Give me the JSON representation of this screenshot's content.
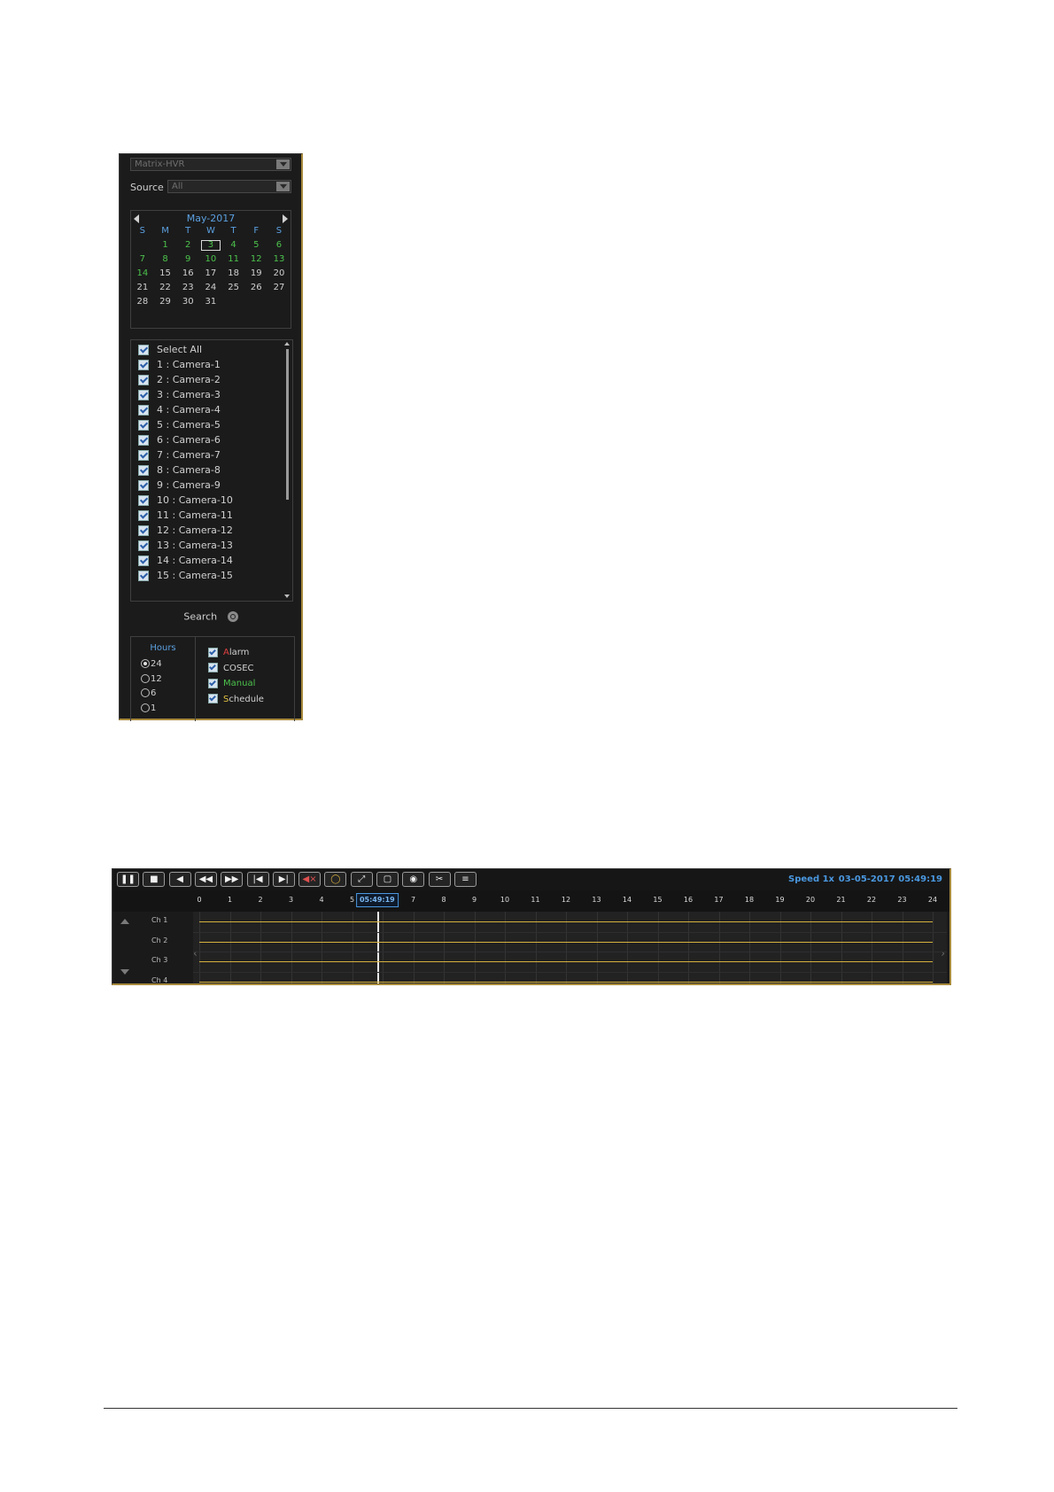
{
  "search_panel": {
    "device_dropdown": "Matrix-HVR",
    "source_label": "Source",
    "source_dropdown": "All",
    "calendar": {
      "title": "May-2017",
      "weekdays": [
        "S",
        "M",
        "T",
        "W",
        "T",
        "F",
        "S"
      ],
      "days": [
        {
          "d": "",
          "c": "nrec"
        },
        {
          "d": "1",
          "c": "rec"
        },
        {
          "d": "2",
          "c": "rec"
        },
        {
          "d": "3",
          "c": "rec sel"
        },
        {
          "d": "4",
          "c": "rec"
        },
        {
          "d": "5",
          "c": "rec"
        },
        {
          "d": "6",
          "c": "rec"
        },
        {
          "d": "7",
          "c": "rec"
        },
        {
          "d": "8",
          "c": "rec"
        },
        {
          "d": "9",
          "c": "rec"
        },
        {
          "d": "10",
          "c": "rec"
        },
        {
          "d": "11",
          "c": "rec"
        },
        {
          "d": "12",
          "c": "rec"
        },
        {
          "d": "13",
          "c": "rec"
        },
        {
          "d": "14",
          "c": "rec"
        },
        {
          "d": "15",
          "c": "nrec"
        },
        {
          "d": "16",
          "c": "nrec"
        },
        {
          "d": "17",
          "c": "nrec"
        },
        {
          "d": "18",
          "c": "nrec"
        },
        {
          "d": "19",
          "c": "nrec"
        },
        {
          "d": "20",
          "c": "nrec"
        },
        {
          "d": "21",
          "c": "nrec"
        },
        {
          "d": "22",
          "c": "nrec"
        },
        {
          "d": "23",
          "c": "nrec"
        },
        {
          "d": "24",
          "c": "nrec"
        },
        {
          "d": "25",
          "c": "nrec"
        },
        {
          "d": "26",
          "c": "nrec"
        },
        {
          "d": "27",
          "c": "nrec"
        },
        {
          "d": "28",
          "c": "nrec"
        },
        {
          "d": "29",
          "c": "nrec"
        },
        {
          "d": "30",
          "c": "nrec"
        },
        {
          "d": "31",
          "c": "nrec"
        }
      ],
      "recorded_color": "#4cc24c",
      "selected_day": "3"
    },
    "cameras": [
      {
        "label": "Select All",
        "checked": true
      },
      {
        "label": "1 : Camera-1",
        "checked": true
      },
      {
        "label": "2 : Camera-2",
        "checked": true
      },
      {
        "label": "3 : Camera-3",
        "checked": true
      },
      {
        "label": "4 : Camera-4",
        "checked": true
      },
      {
        "label": "5 : Camera-5",
        "checked": true
      },
      {
        "label": "6 : Camera-6",
        "checked": true
      },
      {
        "label": "7 : Camera-7",
        "checked": true
      },
      {
        "label": "8 : Camera-8",
        "checked": true
      },
      {
        "label": "9 : Camera-9",
        "checked": true
      },
      {
        "label": "10 : Camera-10",
        "checked": true
      },
      {
        "label": "11 : Camera-11",
        "checked": true
      },
      {
        "label": "12 : Camera-12",
        "checked": true
      },
      {
        "label": "13 : Camera-13",
        "checked": true
      },
      {
        "label": "14 : Camera-14",
        "checked": true
      },
      {
        "label": "15 : Camera-15",
        "checked": true
      }
    ],
    "search_label": "Search",
    "hours": {
      "title": "Hours",
      "options": [
        {
          "label": "24",
          "selected": true
        },
        {
          "label": "12",
          "selected": false
        },
        {
          "label": "6",
          "selected": false
        },
        {
          "label": "1",
          "selected": false
        }
      ]
    },
    "record_types": [
      {
        "first": "A",
        "rest": "larm",
        "color": "#e04040",
        "checked": true
      },
      {
        "first": "C",
        "rest": "OSEC",
        "color": "#d0d0d0",
        "checked": true
      },
      {
        "first": "M",
        "rest": "anual",
        "color": "#4cc24c",
        "checked": true
      },
      {
        "first": "S",
        "rest": "chedule",
        "color": "#e0c040",
        "checked": true
      }
    ]
  },
  "player": {
    "toolbar_buttons": [
      {
        "name": "pause-button",
        "icon": "pause-icon",
        "glyph": "❚❚",
        "cls": ""
      },
      {
        "name": "stop-button",
        "icon": "stop-icon",
        "glyph": "■",
        "cls": ""
      },
      {
        "name": "reverse-play-button",
        "icon": "reverse-play-icon",
        "glyph": "◀",
        "cls": ""
      },
      {
        "name": "slow-button",
        "icon": "rewind-icon",
        "glyph": "◀◀",
        "cls": ""
      },
      {
        "name": "fast-button",
        "icon": "fast-forward-icon",
        "glyph": "▶▶",
        "cls": ""
      },
      {
        "name": "previous-frame-button",
        "icon": "skip-back-icon",
        "glyph": "|◀",
        "cls": ""
      },
      {
        "name": "next-frame-button",
        "icon": "skip-forward-icon",
        "glyph": "▶|",
        "cls": ""
      },
      {
        "name": "mute-button",
        "icon": "mute-icon",
        "glyph": "◀×",
        "cls": "mute"
      },
      {
        "name": "digital-zoom-button",
        "icon": "zoom-ring-icon",
        "glyph": "◯",
        "cls": "ring"
      },
      {
        "name": "fullscreen-button",
        "icon": "fullscreen-icon",
        "glyph": "⤢",
        "cls": ""
      },
      {
        "name": "layout-button",
        "icon": "layout-icon",
        "glyph": "▢",
        "cls": ""
      },
      {
        "name": "snapshot-button",
        "icon": "camera-icon",
        "glyph": "◉",
        "cls": ""
      },
      {
        "name": "clip-button",
        "icon": "scissors-icon",
        "glyph": "✂",
        "cls": ""
      },
      {
        "name": "list-button",
        "icon": "list-icon",
        "glyph": "≡",
        "cls": ""
      }
    ],
    "speed": "Speed  1x",
    "datetime": "03-05-2017  05:49:19",
    "ruler_ticks": [
      "0",
      "1",
      "2",
      "3",
      "4",
      "5",
      "6",
      "7",
      "8",
      "9",
      "10",
      "11",
      "12",
      "13",
      "14",
      "15",
      "16",
      "17",
      "18",
      "19",
      "20",
      "21",
      "22",
      "23",
      "24"
    ],
    "current_time_label": "05:49:19",
    "current_hour": 5.822,
    "channels": [
      "Ch 1",
      "Ch 2",
      "Ch 3",
      "Ch 4"
    ],
    "record_color": "#d6b13e",
    "accent_color": "#4a98e0"
  }
}
